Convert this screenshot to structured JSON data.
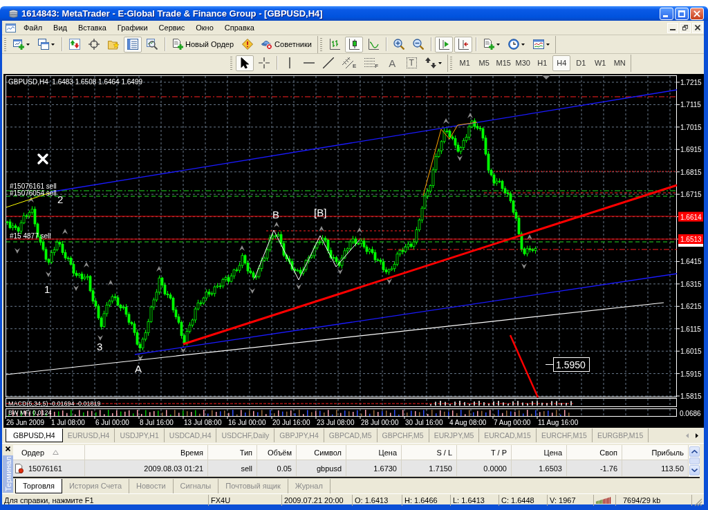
{
  "window": {
    "title": "1614843: MetaTrader - E-Global Trade & Finance Group - [GBPUSD,H4]"
  },
  "menu": [
    "Файл",
    "Вид",
    "Вставка",
    "Графики",
    "Сервис",
    "Окно",
    "Справка"
  ],
  "toolbars": {
    "standard": [
      {
        "kind": "newchart",
        "pressed": false
      },
      {
        "kind": "profiles",
        "pressed": false
      },
      {
        "kind": "separator"
      },
      {
        "kind": "marketwatch",
        "pressed": false
      },
      {
        "kind": "datawindow",
        "pressed": false
      },
      {
        "kind": "navigator",
        "pressed": false
      },
      {
        "kind": "terminal",
        "pressed": true
      },
      {
        "kind": "tester",
        "pressed": false
      },
      {
        "kind": "separator"
      },
      {
        "kind": "neworder",
        "label": "Новый Ордер",
        "pressed": false
      },
      {
        "kind": "editor",
        "pressed": false
      },
      {
        "kind": "experts",
        "label": "Советники",
        "pressed": false
      }
    ],
    "charts": [
      {
        "kind": "bars",
        "pressed": false
      },
      {
        "kind": "candles",
        "pressed": true
      },
      {
        "kind": "line",
        "pressed": false
      },
      {
        "kind": "separator"
      },
      {
        "kind": "zoomin",
        "pressed": false
      },
      {
        "kind": "zoomout",
        "pressed": false
      },
      {
        "kind": "separator"
      },
      {
        "kind": "autoscroll",
        "pressed": true
      },
      {
        "kind": "shift",
        "pressed": true
      },
      {
        "kind": "separator"
      },
      {
        "kind": "indicators",
        "pressed": false
      },
      {
        "kind": "periods",
        "pressed": false
      },
      {
        "kind": "templates",
        "pressed": false
      }
    ],
    "line_studies": [
      {
        "kind": "cursor",
        "pressed": true
      },
      {
        "kind": "crosshair",
        "pressed": false
      },
      {
        "kind": "separator"
      },
      {
        "kind": "vline",
        "pressed": false
      },
      {
        "kind": "hline",
        "pressed": false
      },
      {
        "kind": "trendline",
        "pressed": false
      },
      {
        "kind": "channel",
        "glyph": "E",
        "pressed": false
      },
      {
        "kind": "fibonacci",
        "glyph": "F",
        "pressed": false
      },
      {
        "kind": "text",
        "glyph": "A",
        "pressed": false
      },
      {
        "kind": "label",
        "glyph": "T",
        "pressed": false
      },
      {
        "kind": "arrows",
        "pressed": false
      }
    ],
    "periods": [
      {
        "label": "M1",
        "selected": false
      },
      {
        "label": "M5",
        "selected": false
      },
      {
        "label": "M15",
        "selected": false
      },
      {
        "label": "M30",
        "selected": false
      },
      {
        "label": "H1",
        "selected": false
      },
      {
        "label": "H4",
        "selected": true
      },
      {
        "label": "D1",
        "selected": false
      },
      {
        "label": "W1",
        "selected": false
      },
      {
        "label": "MN",
        "selected": false
      }
    ]
  },
  "chart": {
    "header": "GBPUSD,H4  1.6483 1.6508 1.6464 1.6499",
    "price_scale": [
      {
        "label": "1.7215",
        "kind": "tick"
      },
      {
        "label": "1.7115",
        "kind": "tick"
      },
      {
        "label": "1.7015",
        "kind": "tick"
      },
      {
        "label": "1.6915",
        "kind": "tick"
      },
      {
        "label": "1.6815",
        "kind": "tick"
      },
      {
        "label": "1.6715",
        "kind": "tick"
      },
      {
        "label": "1.6614",
        "kind": "level"
      },
      {
        "label": "1.6513",
        "kind": "level"
      },
      {
        "label": "1.6415",
        "kind": "tick"
      },
      {
        "label": "1.6315",
        "kind": "tick"
      },
      {
        "label": "1.6215",
        "kind": "tick"
      },
      {
        "label": "1.6115",
        "kind": "tick"
      },
      {
        "label": "1.6015",
        "kind": "tick"
      },
      {
        "label": "1.5915",
        "kind": "tick"
      },
      {
        "label": "1.5815",
        "kind": "tick"
      }
    ],
    "dates": [
      "26 Jun 2009",
      "1 Jul 08:00",
      "6 Jul 00:00",
      "8 Jul 16:00",
      "13 Jul 08:00",
      "16 Jul 00:00",
      "20 Jul 16:00",
      "23 Jul 08:00",
      "28 Jul 00:00",
      "30 Jul 16:00",
      "4 Aug 08:00",
      "7 Aug 00:00",
      "11 Aug 16:00"
    ],
    "wave_labels": [
      "2",
      "1",
      "3",
      "A",
      "B",
      "[B]"
    ],
    "order_labels": [
      "#15076161 sell",
      "#15076054 sell",
      "#15 4877 sell"
    ],
    "price_box": "1.5950",
    "indicators": [
      {
        "label": "MACD(5,34,5) -0.01694 -0.01819"
      },
      {
        "label": "BW MFI 0.0124",
        "scale": "0.0686"
      }
    ]
  },
  "chart_tabs": [
    {
      "label": "GBPUSD,H4",
      "selected": true
    },
    {
      "label": "EURUSD,H4",
      "selected": false
    },
    {
      "label": "USDJPY,H1",
      "selected": false
    },
    {
      "label": "USDCAD,H4",
      "selected": false
    },
    {
      "label": "USDCHF,Daily",
      "selected": false
    },
    {
      "label": "GBPJPY,H4",
      "selected": false
    },
    {
      "label": "GBPCAD,M5",
      "selected": false
    },
    {
      "label": "GBPCHF,M5",
      "selected": false
    },
    {
      "label": "EURJPY,M5",
      "selected": false
    },
    {
      "label": "EURCAD,M15",
      "selected": false
    },
    {
      "label": "EURCHF,M15",
      "selected": false
    },
    {
      "label": "EURGBP,M15",
      "selected": false
    }
  ],
  "terminal": {
    "title": "Терминал",
    "columns": [
      {
        "label": "Ордер",
        "sorted": true
      },
      {
        "label": "Время",
        "sorted": false
      },
      {
        "label": "Тип",
        "sorted": false
      },
      {
        "label": "Объём",
        "sorted": false
      },
      {
        "label": "Символ",
        "sorted": false
      },
      {
        "label": "Цена",
        "sorted": false
      },
      {
        "label": "S / L",
        "sorted": false
      },
      {
        "label": "T / P",
        "sorted": false
      },
      {
        "label": "Цена",
        "sorted": false
      },
      {
        "label": "Своп",
        "sorted": false
      },
      {
        "label": "Прибыль",
        "sorted": false
      }
    ],
    "rows": [
      {
        "selected": true,
        "cells": [
          "15076161",
          "2009.08.03 01:21",
          "sell",
          "0.05",
          "gbpusd",
          "1.6730",
          "1.7150",
          "0.0000",
          "1.6503",
          "-1.76",
          "113.50"
        ]
      }
    ],
    "tabs": [
      {
        "label": "Торговля",
        "selected": true
      },
      {
        "label": "История Счета",
        "selected": false
      },
      {
        "label": "Новости",
        "selected": false
      },
      {
        "label": "Сигналы",
        "selected": false
      },
      {
        "label": "Почтовый ящик",
        "selected": false
      },
      {
        "label": "Журнал",
        "selected": false
      }
    ]
  },
  "status_bar": [
    {
      "kind": "text",
      "text": "Для справки, нажмите F1"
    },
    {
      "kind": "text",
      "text": "FX4U"
    },
    {
      "kind": "text",
      "text": "2009.07.21 20:00"
    },
    {
      "kind": "text",
      "text": "O: 1.6413"
    },
    {
      "kind": "text",
      "text": "H: 1.6466"
    },
    {
      "kind": "text",
      "text": "L: 1.6413"
    },
    {
      "kind": "text",
      "text": "C: 1.6448"
    },
    {
      "kind": "text",
      "text": "V: 1967"
    },
    {
      "kind": "meter"
    },
    {
      "kind": "text",
      "text": "7694/29 kb"
    }
  ]
}
